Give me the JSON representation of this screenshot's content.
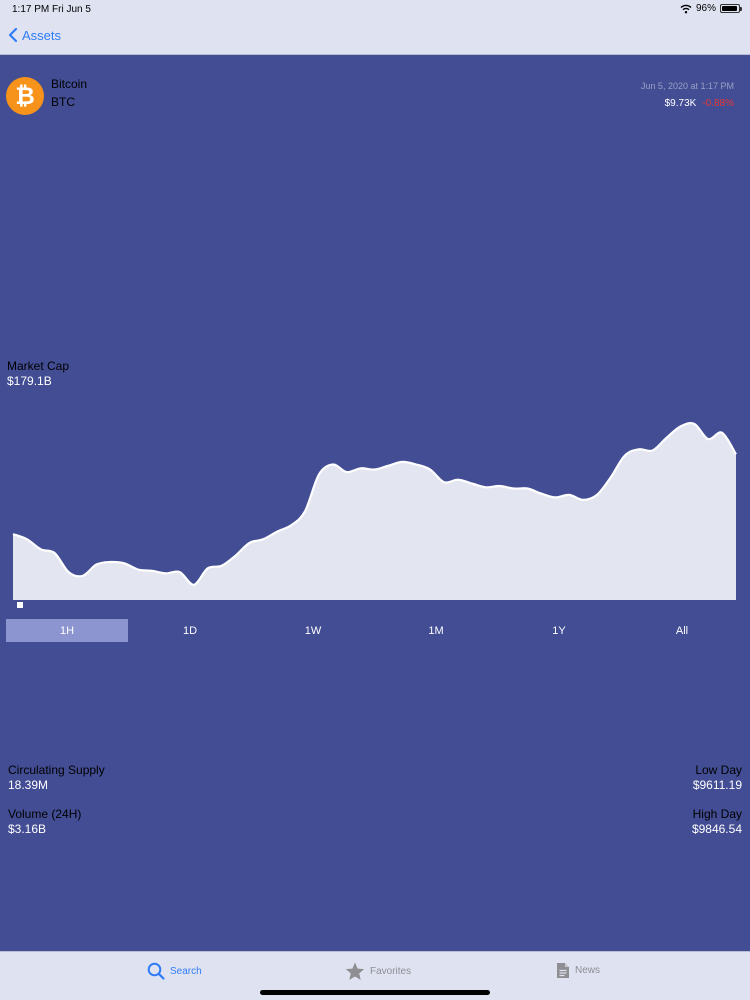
{
  "status_bar": {
    "time": "1:17 PM",
    "date": "Fri Jun 5",
    "battery": "96%",
    "battery_fraction": 0.96
  },
  "nav": {
    "back_label": "Assets"
  },
  "coin": {
    "name": "Bitcoin",
    "symbol": "BTC",
    "logo_glyph": "₿",
    "logo_color": "#f7931a"
  },
  "price": {
    "timestamp": "Jun 5, 2020 at 1:17 PM",
    "value": "$9.73K",
    "change": "-0.88%"
  },
  "market_cap": {
    "label": "Market Cap",
    "value": "$179.1B"
  },
  "ranges": [
    {
      "label": "1H",
      "active": true
    },
    {
      "label": "1D",
      "active": false
    },
    {
      "label": "1W",
      "active": false
    },
    {
      "label": "1M",
      "active": false
    },
    {
      "label": "1Y",
      "active": false
    },
    {
      "label": "All",
      "active": false
    }
  ],
  "stats": {
    "circulating_supply": {
      "label": "Circulating Supply",
      "value": "18.39M"
    },
    "volume": {
      "label": "Volume (24H)",
      "value": "$3.16B"
    },
    "low_day": {
      "label": "Low Day",
      "value": "$9611.19"
    },
    "high_day": {
      "label": "High Day",
      "value": "$9846.54"
    }
  },
  "tabs": [
    {
      "label": "Search",
      "icon": "search-icon",
      "active": true
    },
    {
      "label": "Favorites",
      "icon": "star-icon",
      "active": false
    },
    {
      "label": "News",
      "icon": "news-icon",
      "active": false
    }
  ],
  "colors": {
    "background": "#424d94",
    "accent": "#2f7df6",
    "negative": "#e53935",
    "chart_fill": "#e3e5f1"
  },
  "chart_data": {
    "type": "area",
    "title": "",
    "xlabel": "",
    "ylabel": "",
    "values": [
      9662,
      9658,
      9650,
      9647,
      9632,
      9629,
      9638,
      9640,
      9639,
      9634,
      9633,
      9631,
      9632,
      9622,
      9635,
      9637,
      9645,
      9655,
      9658,
      9664,
      9669,
      9680,
      9709,
      9717,
      9711,
      9714,
      9713,
      9716,
      9719,
      9717,
      9713,
      9703,
      9705,
      9702,
      9699,
      9700,
      9698,
      9698,
      9694,
      9691,
      9693,
      9689,
      9693,
      9707,
      9724,
      9729,
      9728,
      9738,
      9747,
      9749,
      9737,
      9742,
      9725
    ],
    "ylim": [
      9610,
      9760
    ]
  }
}
